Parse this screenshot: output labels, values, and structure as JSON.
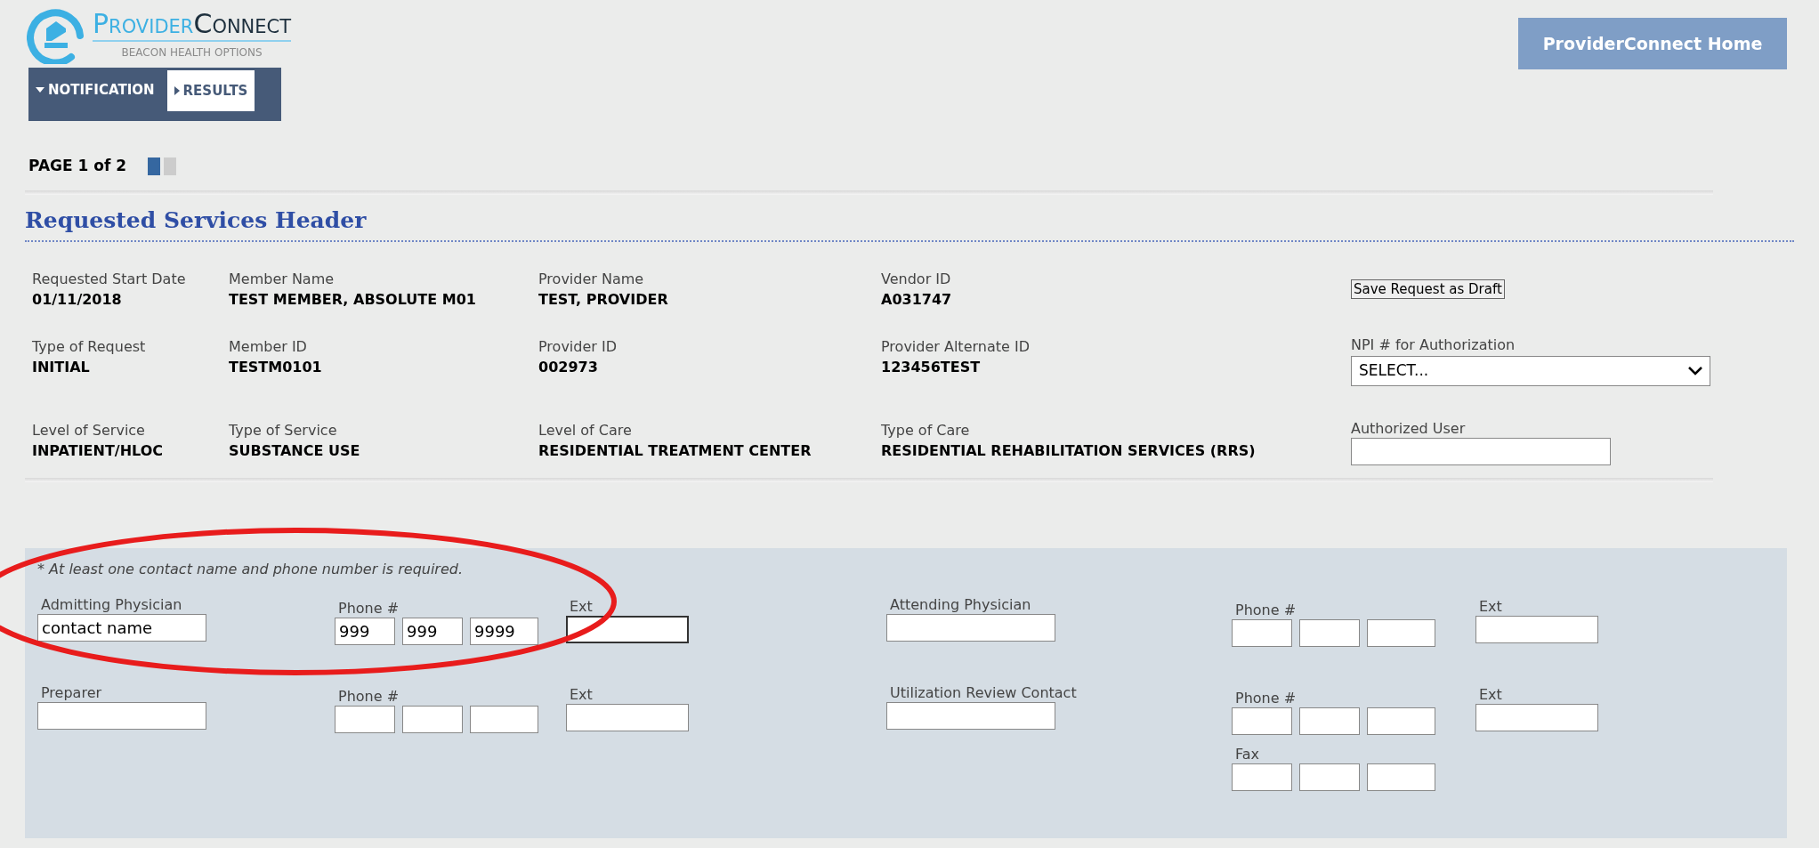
{
  "logo": {
    "brand": [
      "Provider",
      "Connect"
    ],
    "tagline": "BEACON HEALTH OPTIONS"
  },
  "home_button": "ProviderConnect Home",
  "tabs": [
    {
      "label": "NOTIFICATION",
      "selected": true
    },
    {
      "label": "RESULTS",
      "selected": false
    }
  ],
  "pager": {
    "text": "PAGE 1 of 2",
    "pages": [
      {
        "selected": true
      },
      {
        "selected": false
      }
    ]
  },
  "section_title": "Requested Services Header",
  "summary_rows": [
    {
      "cells": [
        {
          "label": "Requested Start Date",
          "value": "01/11/2018"
        },
        {
          "label": "Member  Name",
          "value": "TEST MEMBER,  ABSOLUTE M01"
        },
        {
          "label": "Provider  Name",
          "value": "TEST,  PROVIDER"
        },
        {
          "label": "Vendor ID",
          "value": "A031747"
        }
      ],
      "side": {
        "kind": "button",
        "label": "Save Request as Draft"
      }
    },
    {
      "cells": [
        {
          "label": "Type of Request",
          "value": "INITIAL"
        },
        {
          "label": "Member ID",
          "value": "TESTM0101"
        },
        {
          "label": "Provider ID",
          "value": "002973"
        },
        {
          "label": "Provider  Alternate  ID",
          "value": "123456TEST"
        }
      ],
      "side": {
        "kind": "select",
        "label": "NPI # for Authorization",
        "value": "SELECT..."
      }
    },
    {
      "cells": [
        {
          "label": "Level of Service",
          "value": "INPATIENT/HLOC"
        },
        {
          "label": "Type of Service",
          "value": "SUBSTANCE USE"
        },
        {
          "label": "Level of Care",
          "value": "RESIDENTIAL TREATMENT CENTER"
        },
        {
          "label": "Type of Care",
          "value": "RESIDENTIAL REHABILITATION SERVICES (RRS)"
        }
      ],
      "side": {
        "kind": "field",
        "label": "Authorized User"
      }
    }
  ],
  "contact_note": "* At least one contact name and phone number is required.",
  "contacts": [
    {
      "name": {
        "label": "Admitting Physician",
        "value": "contact name",
        "focused": false
      },
      "phone": {
        "label": "Phone #",
        "fields": [
          {
            "value": "999",
            "focused": false
          },
          {
            "value": "999",
            "focused": false
          },
          {
            "value": "9999",
            "focused": false
          }
        ]
      },
      "ext": {
        "label": "Ext",
        "focused": true
      }
    },
    {
      "name": {
        "label": "Attending Physician",
        "focused": false
      },
      "phone": {
        "label": "Phone #",
        "fields": [
          {
            "focused": false
          },
          {
            "focused": false
          },
          {
            "focused": false
          }
        ]
      },
      "ext": {
        "label": "Ext",
        "focused": false
      }
    },
    {
      "name": {
        "label": "Preparer",
        "focused": false
      },
      "phone": {
        "label": "Phone #",
        "fields": [
          {
            "focused": false
          },
          {
            "focused": false
          },
          {
            "focused": false
          }
        ]
      },
      "ext": {
        "label": "Ext",
        "focused": false
      }
    },
    {
      "name": {
        "label": "Utilization Review Contact",
        "focused": false
      },
      "phone": {
        "label": "Phone #",
        "fields": [
          {
            "focused": false
          },
          {
            "focused": false
          },
          {
            "focused": false
          }
        ]
      },
      "ext": {
        "label": "Ext",
        "focused": false
      },
      "fax": {
        "label": "Fax",
        "fields": [
          {
            "focused": false
          },
          {
            "focused": false
          },
          {
            "focused": false
          }
        ]
      }
    }
  ]
}
